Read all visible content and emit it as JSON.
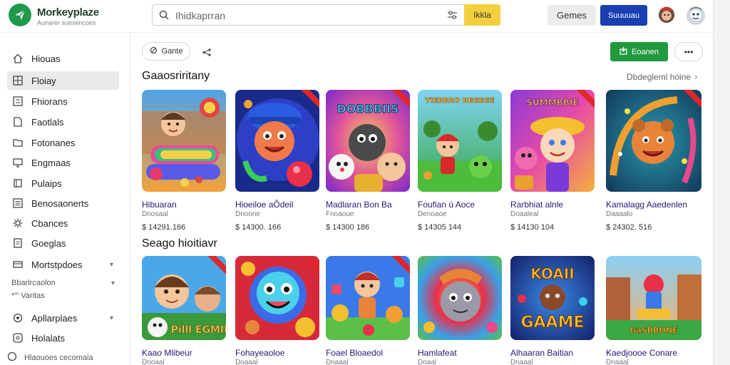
{
  "colors": {
    "brand_green": "#1e9a4a",
    "search_button": "#f4d03f",
    "primary_blue": "#1a3fb3",
    "install_green": "#219a3e",
    "card_title": "#221b73",
    "ribbon": "#e0262a"
  },
  "header": {
    "logo_name": "Morkeyplaze",
    "logo_tagline": "Aunarer suesencoes",
    "search_text": "Ihidkaprran",
    "search_button": "Ikkla",
    "games_button": "Gemes",
    "primary_button": "Suuuuau",
    "icons": {
      "logo": "send-icon",
      "search": "search-icon",
      "filter": "sliders-icon"
    }
  },
  "sidebar": {
    "items": [
      {
        "label": "Hiouas",
        "icon": "home-icon",
        "active": false
      },
      {
        "label": "Floiay",
        "icon": "grid-icon",
        "active": true
      },
      {
        "label": "Fhiorans",
        "icon": "list-icon",
        "active": false
      },
      {
        "label": "Faotlals",
        "icon": "document-icon",
        "active": false
      },
      {
        "label": "Fotonanes",
        "icon": "folder-icon",
        "active": false
      },
      {
        "label": "Engmaas",
        "icon": "monitor-icon",
        "active": false
      },
      {
        "label": "Pulaips",
        "icon": "cart-icon",
        "active": false
      },
      {
        "label": "Benosaonerts",
        "icon": "list-icon",
        "active": false
      },
      {
        "label": "Cbances",
        "icon": "gear-icon",
        "active": false
      },
      {
        "label": "Goeglas",
        "icon": "file-icon",
        "active": false
      },
      {
        "label": "Mortstpdoes",
        "icon": "card-icon",
        "active": false,
        "expandable": true
      }
    ],
    "sub_line1": "Bbarlrcaolon",
    "sub_line2": "*\"' Varitas",
    "items2": [
      {
        "label": "Apllarplaes",
        "icon": "pin-icon",
        "active": false,
        "expandable": true
      },
      {
        "label": "Holalats",
        "icon": "help-icon",
        "active": false
      }
    ],
    "footer_text": "Hlaouoes cecomaia"
  },
  "toolbar": {
    "chip_label": "Gante",
    "install_button": "Eoanen",
    "more_label": "•••"
  },
  "sections": [
    {
      "title": "Gaaosriritany",
      "see_all": "Dbdegleml hoine",
      "games": [
        {
          "title": "Hibuaran",
          "subtitle": "Dnosaal",
          "price": "$ 14291.166",
          "ribbon": false
        },
        {
          "title": "Hioeiloe aÔdeil",
          "subtitle": "Dnoone",
          "price": "$ 14300. 166",
          "ribbon": true
        },
        {
          "title": "Madlaran Bon Ba",
          "subtitle": "Fnoaoue",
          "price": "$ 14300 186",
          "ribbon": true
        },
        {
          "title": "Foufian ú Aoce",
          "subtitle": "Denoaoe",
          "price": "$ 14305 144",
          "ribbon": false
        },
        {
          "title": "Rarbhiat alnle",
          "subtitle": "Doaaleal",
          "price": "$ 14130 104",
          "ribbon": true
        },
        {
          "title": "Kamalagg Aaedenlen",
          "subtitle": "Daaaalo",
          "price": "$ 24302. 516",
          "ribbon": true
        }
      ]
    },
    {
      "title": "Seago hioitiavr",
      "games": [
        {
          "title": "Kaao Mlibeur",
          "subtitle": "Dnoaal",
          "ribbon": true
        },
        {
          "title": "Fohayeaoloe",
          "subtitle": "Doaaal",
          "ribbon": true
        },
        {
          "title": "Foael Bloaedol",
          "subtitle": "Dnaaal",
          "ribbon": true
        },
        {
          "title": "Hamlafeat",
          "subtitle": "Doaal",
          "ribbon": false
        },
        {
          "title": "Alhaaran Baitian",
          "subtitle": "Dnaaal",
          "ribbon": false
        },
        {
          "title": "Kaedjoooe Conare",
          "subtitle": "Dnaaal",
          "ribbon": false
        }
      ]
    }
  ],
  "art_text": {
    "g1": "DOBBBIIS",
    "g3": "TIEBBRO BEGEGE",
    "g4": "SUMMBBIE",
    "g7": "Pilll EGMIRE",
    "g11a": "KOAII",
    "g11b": "GAAME",
    "g12": "GaSBBONE"
  }
}
